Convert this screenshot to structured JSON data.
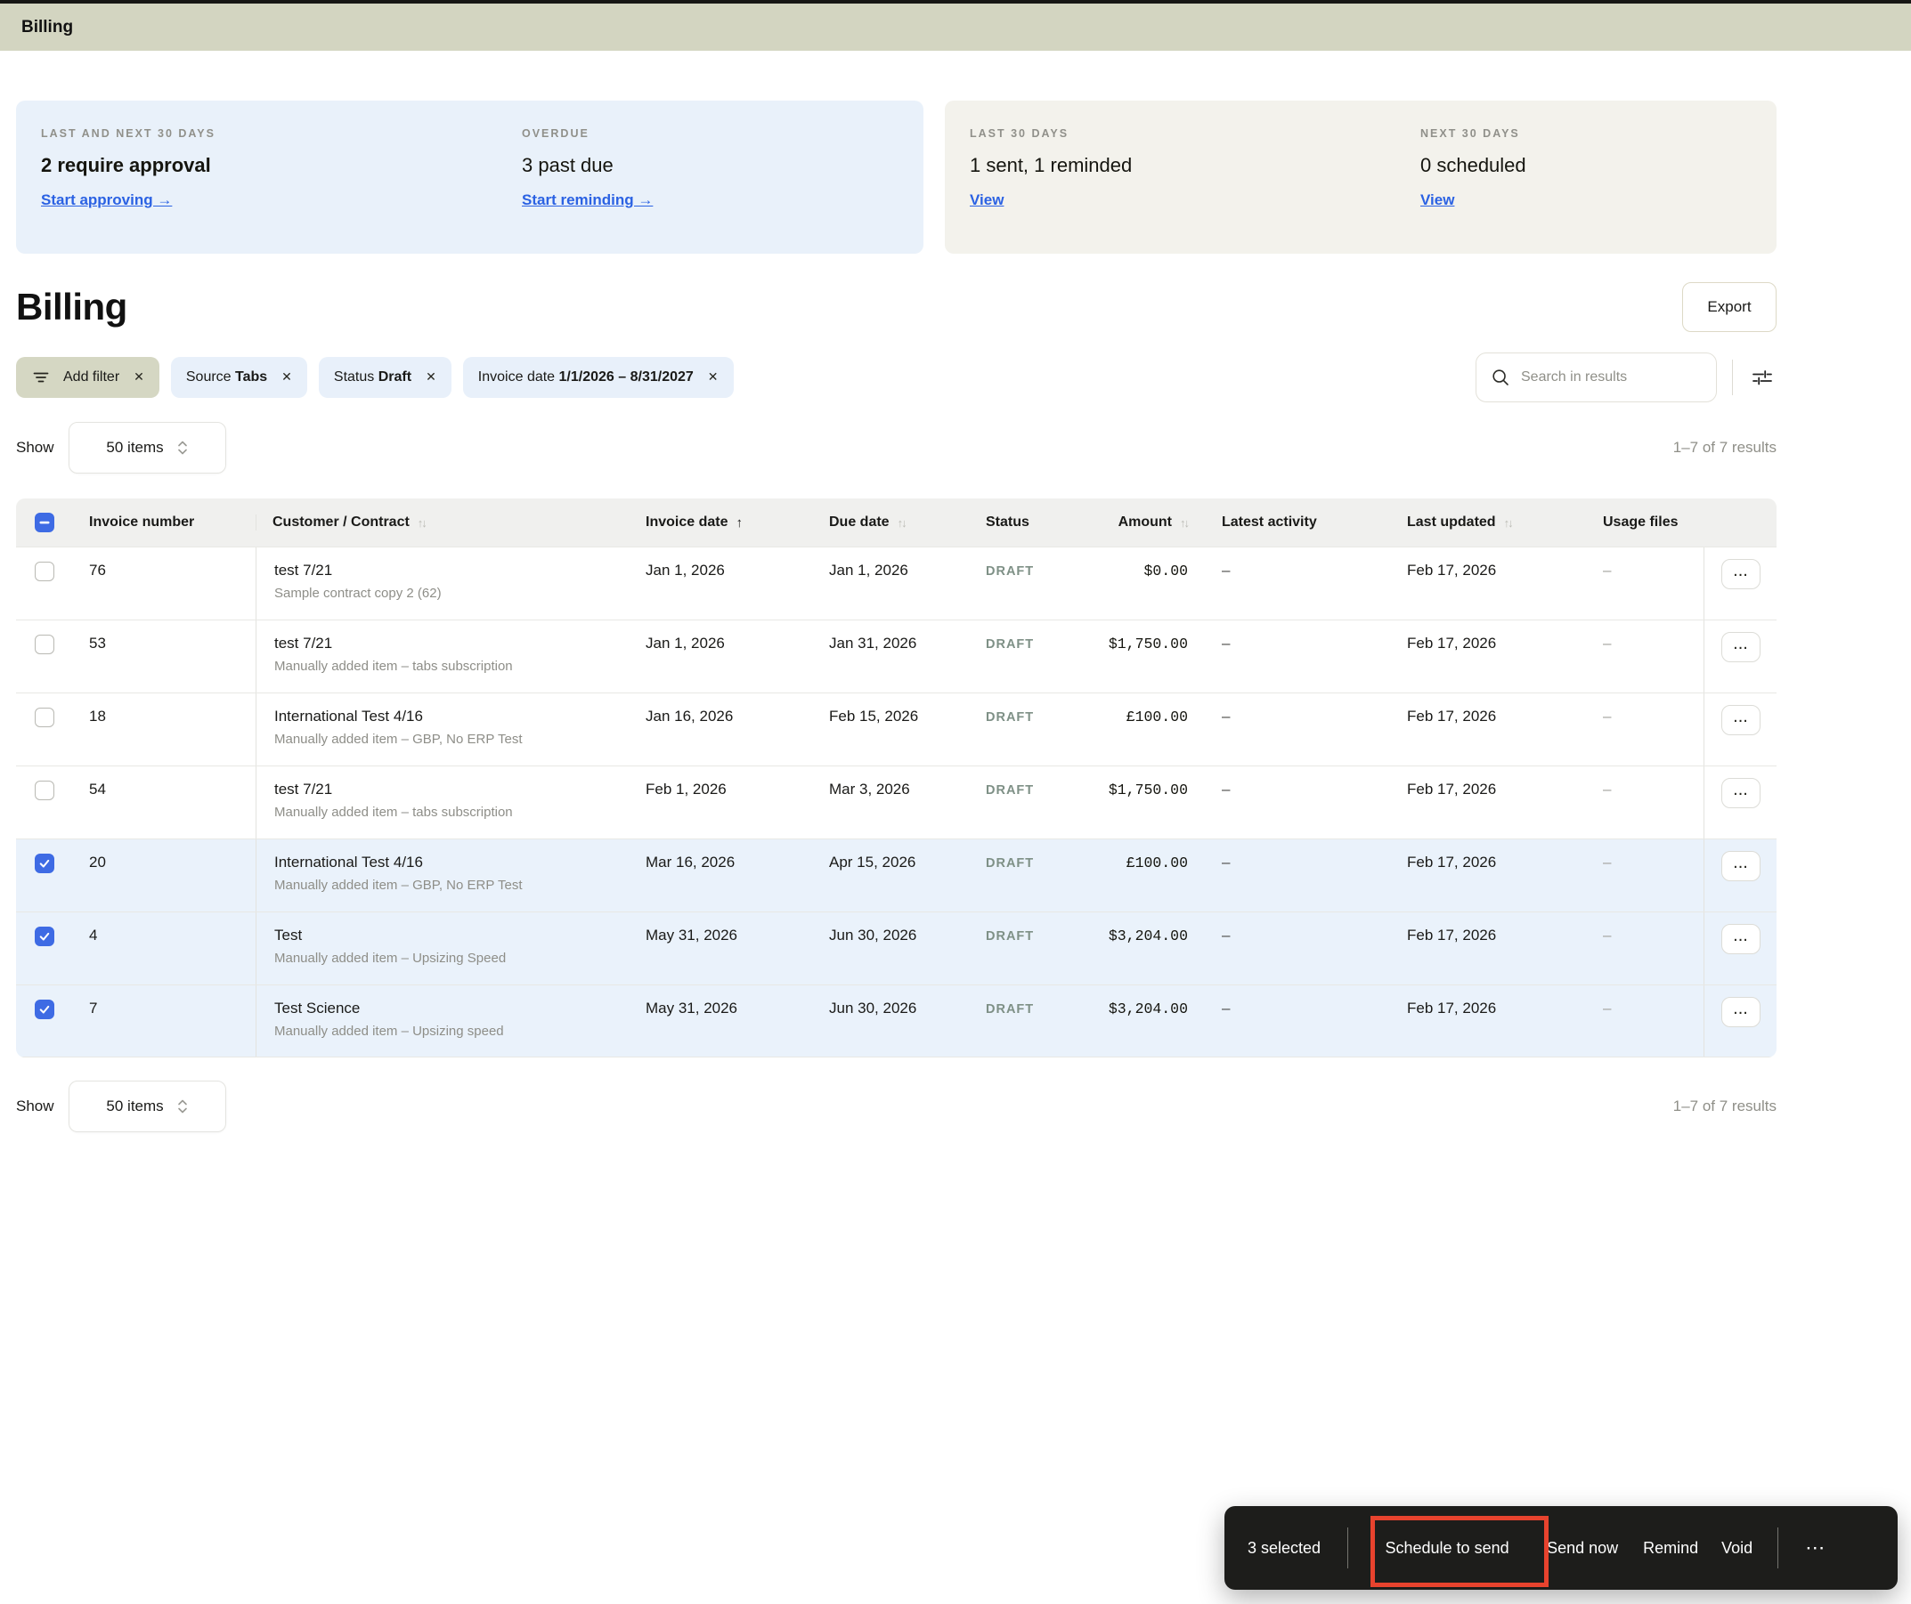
{
  "topbar": {
    "title": "Billing"
  },
  "summary_cards": [
    {
      "style": "blue",
      "bg": "#e9f1fa",
      "items": [
        {
          "label": "LAST AND NEXT 30 DAYS",
          "value": "2 require approval",
          "bold": true,
          "link": "Start approving →",
          "link_name": "start-approving-link"
        },
        {
          "label": "OVERDUE",
          "value": "3 past due",
          "bold": false,
          "link": "Start reminding →",
          "link_name": "start-reminding-link"
        }
      ]
    },
    {
      "style": "tan",
      "bg": "#f3f2ec",
      "items": [
        {
          "label": "LAST 30 DAYS",
          "value": "1 sent, 1 reminded",
          "bold": false,
          "link": "View",
          "link_name": "view-sent-link"
        },
        {
          "label": "NEXT 30 DAYS",
          "value": "0 scheduled",
          "bold": false,
          "link": "View",
          "link_name": "view-scheduled-link"
        }
      ]
    }
  ],
  "page": {
    "title": "Billing",
    "export_label": "Export"
  },
  "filters": {
    "add_filter_label": "Add filter",
    "chips": [
      {
        "prefix": "Source",
        "value": "Tabs"
      },
      {
        "prefix": "Status",
        "value": "Draft"
      },
      {
        "prefix": "Invoice date",
        "value": "1/1/2026 – 8/31/2027"
      }
    ]
  },
  "search": {
    "placeholder": "Search in results"
  },
  "pagination": {
    "show_label": "Show",
    "page_size": "50 items",
    "results": "1–7 of 7 results"
  },
  "table": {
    "columns": [
      {
        "label": "",
        "type": "checkbox"
      },
      {
        "label": "Invoice number"
      },
      {
        "label": "Customer / Contract",
        "sort": "both"
      },
      {
        "label": "Invoice date",
        "sort": "asc"
      },
      {
        "label": "Due date",
        "sort": "both"
      },
      {
        "label": "Status"
      },
      {
        "label": "Amount",
        "sort": "both",
        "align": "right"
      },
      {
        "label": "Latest activity"
      },
      {
        "label": "Last updated",
        "sort": "both"
      },
      {
        "label": "Usage files"
      },
      {
        "label": "",
        "type": "actions"
      }
    ],
    "rows": [
      {
        "checked": false,
        "invoice_number": "76",
        "customer": "test 7/21",
        "contract": "Sample contract copy 2 (62)",
        "invoice_date": "Jan 1, 2026",
        "due_date": "Jan 1, 2026",
        "status": "DRAFT",
        "amount": "$0.00",
        "latest_activity": "–",
        "last_updated": "Feb 17, 2026",
        "usage_files": "–"
      },
      {
        "checked": false,
        "invoice_number": "53",
        "customer": "test 7/21",
        "contract": "Manually added item – tabs subscription",
        "invoice_date": "Jan 1, 2026",
        "due_date": "Jan 31, 2026",
        "status": "DRAFT",
        "amount": "$1,750.00",
        "latest_activity": "–",
        "last_updated": "Feb 17, 2026",
        "usage_files": "–"
      },
      {
        "checked": false,
        "invoice_number": "18",
        "customer": "International Test 4/16",
        "contract": "Manually added item – GBP, No ERP Test",
        "invoice_date": "Jan 16, 2026",
        "due_date": "Feb 15, 2026",
        "status": "DRAFT",
        "amount": "£100.00",
        "latest_activity": "–",
        "last_updated": "Feb 17, 2026",
        "usage_files": "–"
      },
      {
        "checked": false,
        "invoice_number": "54",
        "customer": "test 7/21",
        "contract": "Manually added item – tabs subscription",
        "invoice_date": "Feb 1, 2026",
        "due_date": "Mar 3, 2026",
        "status": "DRAFT",
        "amount": "$1,750.00",
        "latest_activity": "–",
        "last_updated": "Feb 17, 2026",
        "usage_files": "–"
      },
      {
        "checked": true,
        "invoice_number": "20",
        "customer": "International Test 4/16",
        "contract": "Manually added item – GBP, No ERP Test",
        "invoice_date": "Mar 16, 2026",
        "due_date": "Apr 15, 2026",
        "status": "DRAFT",
        "amount": "£100.00",
        "latest_activity": "–",
        "last_updated": "Feb 17, 2026",
        "usage_files": "–"
      },
      {
        "checked": true,
        "invoice_number": "4",
        "customer": "Test",
        "contract": "Manually added item – Upsizing Speed",
        "invoice_date": "May 31, 2026",
        "due_date": "Jun 30, 2026",
        "status": "DRAFT",
        "amount": "$3,204.00",
        "latest_activity": "–",
        "last_updated": "Feb 17, 2026",
        "usage_files": "–"
      },
      {
        "checked": true,
        "invoice_number": "7",
        "customer": "Test Science",
        "contract": "Manually added item – Upsizing speed",
        "invoice_date": "May 31, 2026",
        "due_date": "Jun 30, 2026",
        "status": "DRAFT",
        "amount": "$3,204.00",
        "latest_activity": "–",
        "last_updated": "Feb 17, 2026",
        "usage_files": "–"
      }
    ]
  },
  "action_bar": {
    "selected_label": "3 selected",
    "actions": [
      "Schedule to send",
      "Send now",
      "Remind",
      "Void"
    ],
    "more_label": "⋯",
    "highlighted_action": "Schedule to send"
  },
  "colors": {
    "topbar_olive": "#d3d5c1",
    "card_blue_bg": "#e9f1fa",
    "card_tan_bg": "#f3f2ec",
    "link_blue": "#2b62e3",
    "checkbox_blue": "#3e6be4",
    "selected_row_bg": "#eaf2fb",
    "status_draft": "#7e9086",
    "action_bar_bg": "#1d1d1b",
    "annotation_red": "#e8432e"
  }
}
